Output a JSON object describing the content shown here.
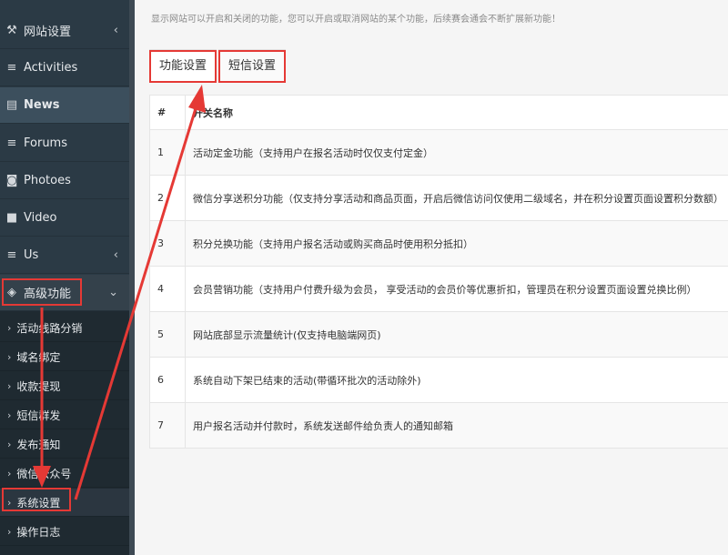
{
  "sidebar": {
    "items": [
      {
        "label": "网站设置",
        "icon": "wrench-icon",
        "glyph": "🔧",
        "chevron": "‹"
      },
      {
        "label": "Activities",
        "icon": "list-icon",
        "glyph": "≡",
        "chevron": ""
      },
      {
        "label": "News",
        "icon": "newspaper-icon",
        "glyph": "▤",
        "chevron": ""
      },
      {
        "label": "Forums",
        "icon": "list-icon",
        "glyph": "≡",
        "chevron": ""
      },
      {
        "label": "Photoes",
        "icon": "camera-icon",
        "glyph": "◙",
        "chevron": ""
      },
      {
        "label": "Video",
        "icon": "video-icon",
        "glyph": "■",
        "chevron": ""
      },
      {
        "label": "Us",
        "icon": "list-icon",
        "glyph": "≡",
        "chevron": "‹"
      },
      {
        "label": "高级功能",
        "icon": "cube-icon",
        "glyph": "◈",
        "chevron": "⌄"
      }
    ],
    "submenu": [
      "活动线路分销",
      "域名绑定",
      "收款提现",
      "短信群发",
      "发布通知",
      "微信公众号",
      "系统设置",
      "操作日志"
    ],
    "arrow_glyph": "›"
  },
  "main": {
    "notice": "显示网站可以开启和关闭的功能，您可以开启或取消网站的某个功能，后续赛会通会不断扩展新功能！",
    "tabs": [
      "功能设置",
      "短信设置"
    ],
    "table": {
      "headers": [
        "#",
        "开关名称"
      ],
      "rows": [
        {
          "num": "1",
          "name": "活动定金功能（支持用户在报名活动时仅仅支付定金）"
        },
        {
          "num": "2",
          "name": "微信分享送积分功能（仅支持分享活动和商品页面，开启后微信访问仅使用二级域名，并在积分设置页面设置积分数额）"
        },
        {
          "num": "3",
          "name": "积分兑换功能（支持用户报名活动或购买商品时使用积分抵扣）"
        },
        {
          "num": "4",
          "name": "会员营销功能（支持用户付费升级为会员， 享受活动的会员价等优惠折扣，管理员在积分设置页面设置兑换比例）"
        },
        {
          "num": "5",
          "name": "网站底部显示流量统计(仅支持电脑端网页)"
        },
        {
          "num": "6",
          "name": "系统自动下架已结束的活动(带循环批次的活动除外)"
        },
        {
          "num": "7",
          "name": "用户报名活动并付款时，系统发送邮件给负责人的通知邮箱"
        }
      ]
    }
  },
  "colors": {
    "sidebar_bg": "#2b3a45",
    "submenu_bg": "#1f2a31",
    "annotation_red": "#e53935"
  }
}
